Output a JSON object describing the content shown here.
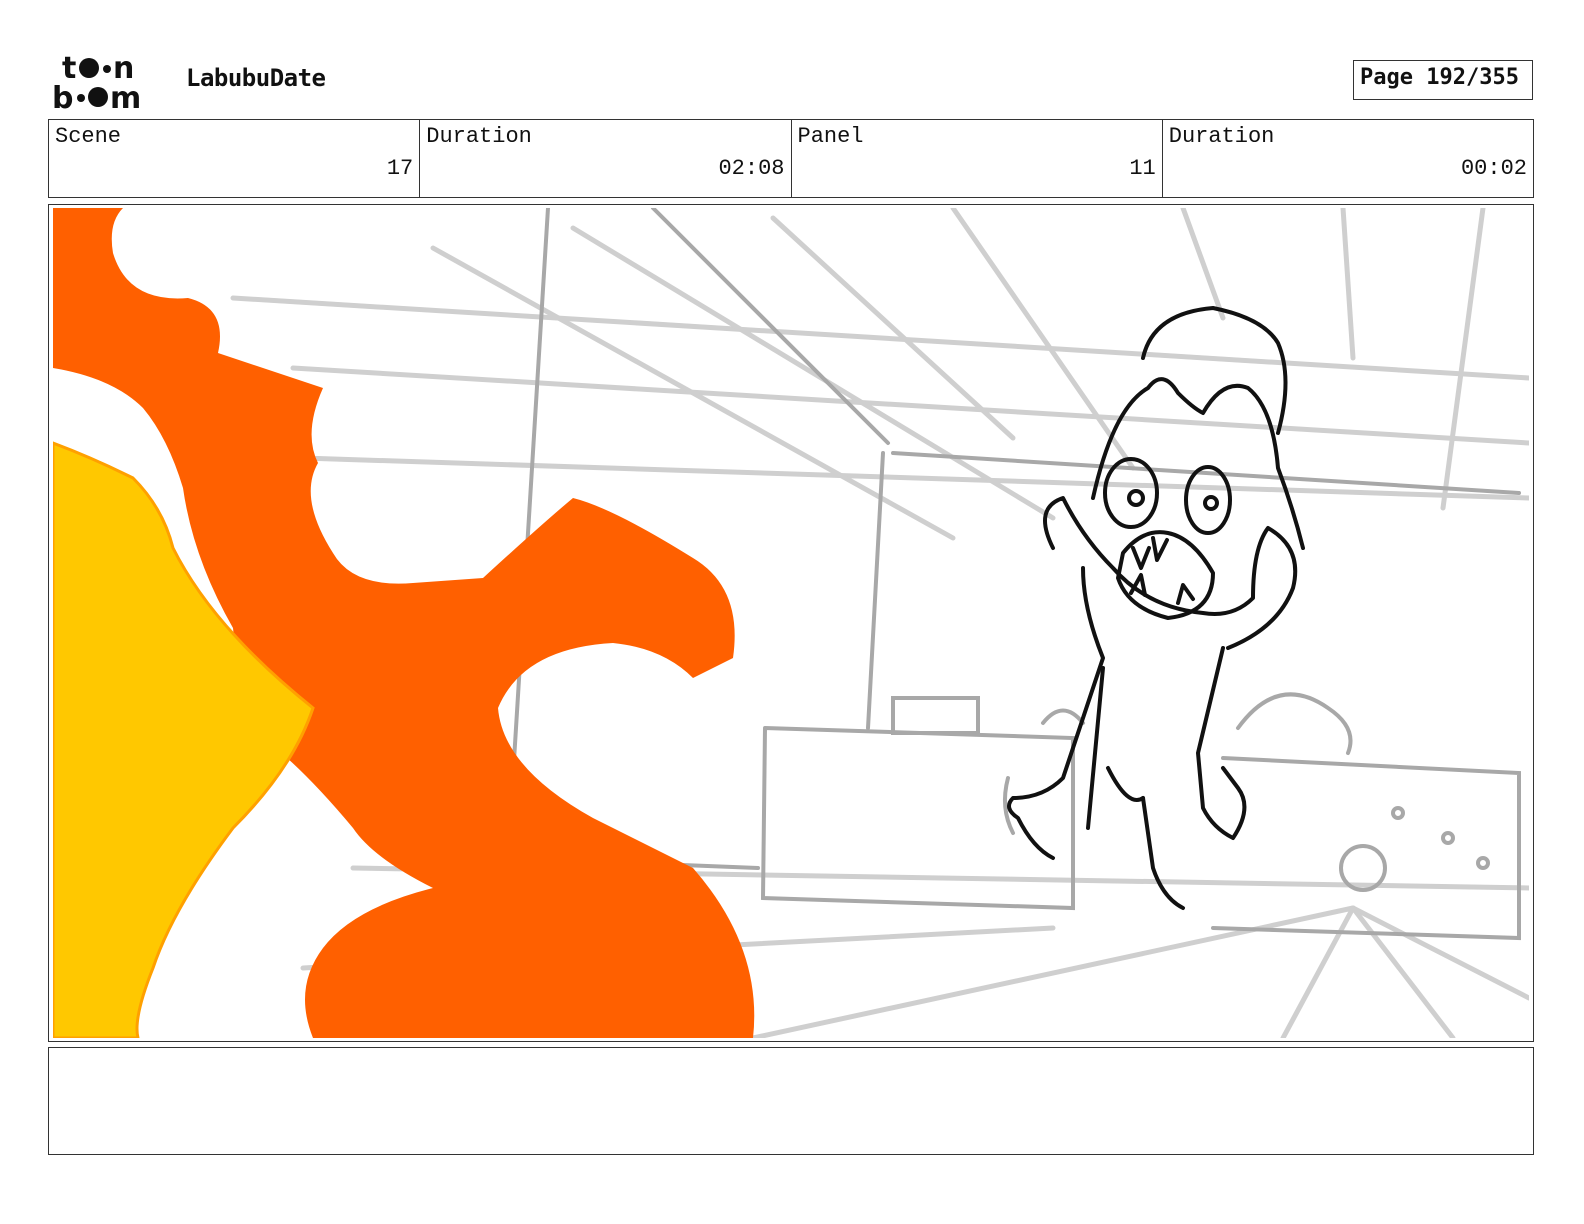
{
  "header": {
    "logo_text": "toon boom",
    "project_title": "LabubuDate",
    "page_label": "Page 192/355"
  },
  "info": {
    "scene": {
      "label": "Scene",
      "value": "17"
    },
    "scene_duration": {
      "label": "Duration",
      "value": "02:08"
    },
    "panel": {
      "label": "Panel",
      "value": "11"
    },
    "panel_duration": {
      "label": "Duration",
      "value": "00:02"
    }
  },
  "colors": {
    "flame_orange": "#ff6000",
    "flame_yellow": "#ffc800",
    "sketch_gray": "#c8c8c8",
    "line_black": "#111111"
  },
  "notes": {
    "text": ""
  }
}
